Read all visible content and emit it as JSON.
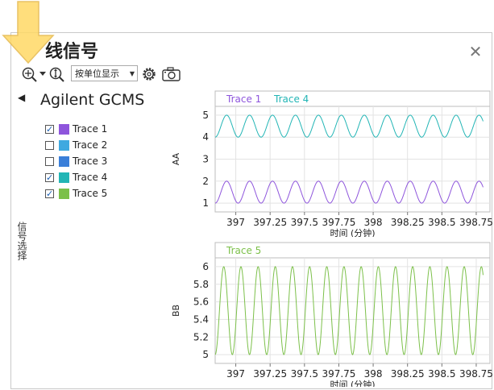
{
  "window": {
    "title": "线信号",
    "close_glyph": "✕"
  },
  "toolbar": {
    "zoom_icon": "zoom-crosshair-icon",
    "zoom_y_icon": "zoom-y-icon",
    "unit_select": {
      "selected": "按单位显示"
    },
    "settings_icon": "gear-icon",
    "snapshot_icon": "camera-icon"
  },
  "signal_panel": {
    "collapse_glyph": "◀",
    "instrument": "Agilent GCMS",
    "side_label": "信号选择",
    "traces": [
      {
        "label": "Trace 1",
        "checked": true,
        "color": "#8e55dc"
      },
      {
        "label": "Trace 2",
        "checked": false,
        "color": "#3fa9e0"
      },
      {
        "label": "Trace 3",
        "checked": false,
        "color": "#3a7fd9"
      },
      {
        "label": "Trace 4",
        "checked": true,
        "color": "#22b5b5"
      },
      {
        "label": "Trace 5",
        "checked": true,
        "color": "#7cc04a"
      }
    ]
  },
  "highlight_arrow_color": "#ffd966",
  "chart_data": [
    {
      "type": "line",
      "ylabel": "AA",
      "xlabel": "时间 (分钟)",
      "xlim": [
        396.85,
        398.85
      ],
      "ylim": [
        0.6,
        5.4
      ],
      "xticks": [
        "397",
        "397.25",
        "397.5",
        "397.75",
        "398",
        "398.25",
        "398.5",
        "398.75"
      ],
      "yticks": [
        "1",
        "2",
        "3",
        "4",
        "5"
      ],
      "grid": true,
      "legend": "top-left",
      "series": [
        {
          "name": "Trace 1",
          "color": "#8e55dc",
          "center": 1.5,
          "amplitude": 0.5,
          "period_min": 0.167,
          "x_range": [
            396.85,
            398.8
          ]
        },
        {
          "name": "Trace 4",
          "color": "#22b5b5",
          "center": 4.5,
          "amplitude": 0.5,
          "period_min": 0.167,
          "x_range": [
            396.85,
            398.8
          ]
        }
      ]
    },
    {
      "type": "line",
      "ylabel": "BB",
      "xlabel": "时间 (分钟)",
      "xlim": [
        396.85,
        398.85
      ],
      "ylim": [
        4.9,
        6.1
      ],
      "xticks": [
        "397",
        "397.25",
        "397.5",
        "397.75",
        "398",
        "398.25",
        "398.5",
        "398.75"
      ],
      "yticks": [
        "5",
        "5.2",
        "5.4",
        "5.6",
        "5.8",
        "6"
      ],
      "grid": true,
      "legend": "top-left",
      "series": [
        {
          "name": "Trace 5",
          "color": "#7cc04a",
          "center": 5.5,
          "amplitude": 0.5,
          "period_min": 0.125,
          "x_range": [
            396.85,
            398.8
          ]
        }
      ]
    }
  ]
}
